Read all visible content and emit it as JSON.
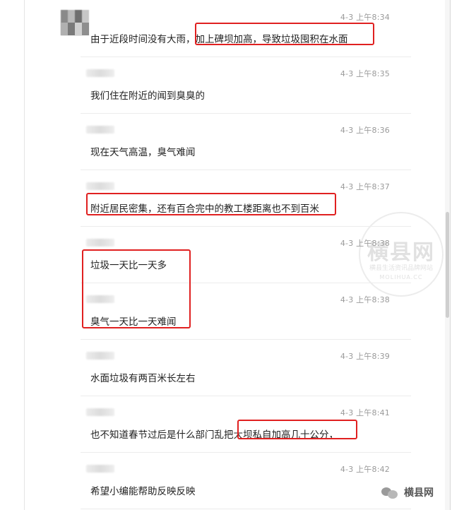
{
  "messages": [
    {
      "time": "4-3 上午8:34",
      "text": "由于近段时间没有大雨，加上碑坝加高，导致垃圾囤积在水面"
    },
    {
      "time": "4-3 上午8:35",
      "text": "我们住在附近的闻到臭臭的"
    },
    {
      "time": "4-3 上午8:36",
      "text": "现在天气高温，臭气难闻"
    },
    {
      "time": "4-3 上午8:37",
      "text": "附近居民密集，还有百合完中的教工楼距离也不到百米"
    },
    {
      "time": "4-3 上午8:38",
      "text": "垃圾一天比一天多"
    },
    {
      "time": "4-3 上午8:38",
      "text": "臭气一天比一天难闻"
    },
    {
      "time": "4-3 上午8:39",
      "text": "水面垃圾有两百米长左右"
    },
    {
      "time": "4-3 上午8:41",
      "text": "也不知道春节过后是什么部门乱把大坝私自加高几十公分，"
    },
    {
      "time": "4-3 上午8:42",
      "text": "希望小编能帮助反映反映"
    }
  ],
  "watermark": {
    "title": "横县网",
    "subtitle": "横县生活资讯品牌网站",
    "en": "MOLIHUA.CC"
  },
  "brand": {
    "name": "横县网",
    "icon": "wechat-icon"
  },
  "colors": {
    "highlight": "#e02020",
    "timestamp": "#9a9a9a"
  }
}
